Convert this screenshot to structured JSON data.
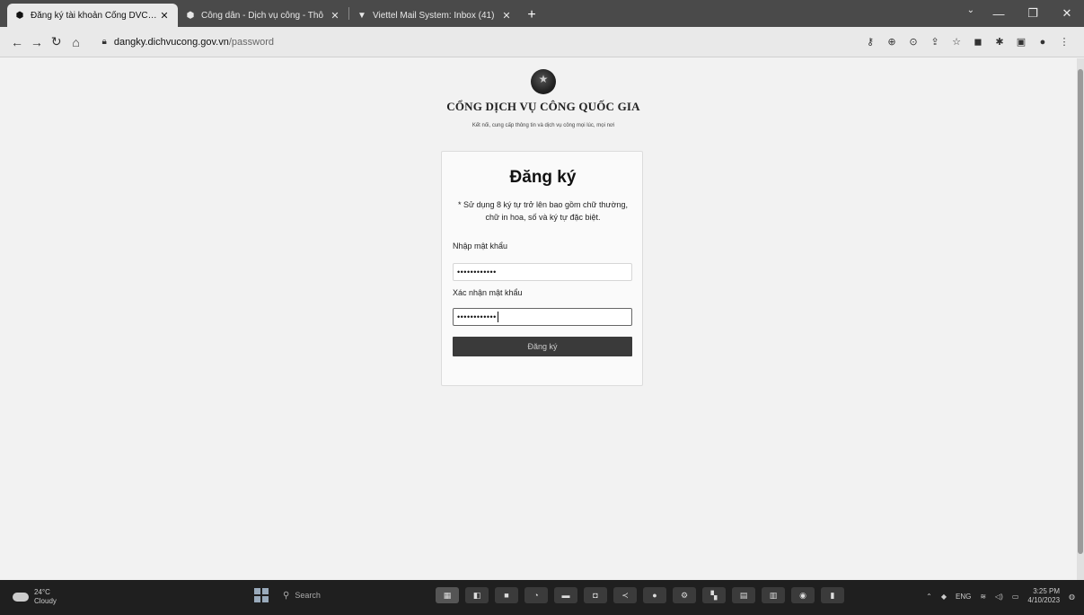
{
  "browser": {
    "tabs": [
      {
        "title": "Đăng ký tài khoản Cổng DVC qu",
        "active": true
      },
      {
        "title": "Công dân - Dịch vụ công - Thô",
        "active": false
      },
      {
        "title": "Viettel Mail System: Inbox (41)",
        "active": false
      }
    ],
    "new_tab": "+",
    "url_host": "dangky.dichvucong.gov.vn",
    "url_path": "/password"
  },
  "portal": {
    "title": "CỔNG DỊCH VỤ CÔNG QUỐC GIA",
    "subtitle": "Kết nối, cung cấp thông tin và dịch vụ công mọi lúc, mọi nơi"
  },
  "form": {
    "title": "Đăng ký",
    "note": "* Sử dụng 8 ký tự trở lên bao gồm chữ thường, chữ in hoa, số và ký tự đặc biệt.",
    "password_label": "Nhập mật khẩu",
    "password_value": "••••••••••••",
    "confirm_label": "Xác nhận mật khẩu",
    "confirm_value": "••••••••••••",
    "submit_label": "Đăng ký"
  },
  "taskbar": {
    "weather_temp": "24°C",
    "weather_desc": "Cloudy",
    "search_placeholder": "Search",
    "lang": "ENG",
    "time": "3:25 PM",
    "date": "4/10/2023"
  },
  "colors": {
    "tabstrip": "#4a4a4a",
    "button": "#3a3a3a",
    "taskbar": "#1f1f1f"
  }
}
